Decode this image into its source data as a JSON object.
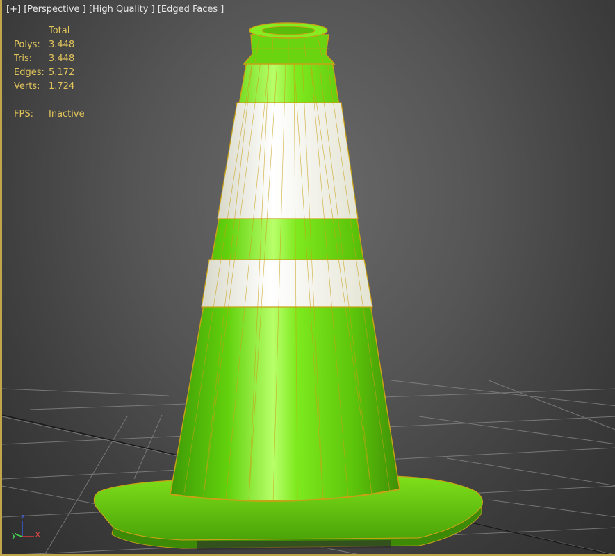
{
  "viewport": {
    "labels": {
      "plus": "[+]",
      "view": "[Perspective ]",
      "shading": "[High Quality ]",
      "edges": "[Edged Faces ]"
    },
    "stats": {
      "header": "Total",
      "rows": [
        {
          "key": "Polys:",
          "value": "3.448"
        },
        {
          "key": "Tris:",
          "value": "3.448"
        },
        {
          "key": "Edges:",
          "value": "5.172"
        },
        {
          "key": "Verts:",
          "value": "1.724"
        }
      ],
      "fps_key": "FPS:",
      "fps_value": "Inactive"
    },
    "gizmo": {
      "x": "x",
      "y": "y",
      "z": "z"
    },
    "colors": {
      "background": "#4d4d4d",
      "cone_green": "#6ce30c",
      "reflective_band": "#f4f4ea",
      "wireframe": "#c8a215",
      "grid": "#8a8a8a",
      "label_text": "#e6e6e6",
      "stats_text": "#e0c45a"
    },
    "object": "traffic-cone"
  }
}
